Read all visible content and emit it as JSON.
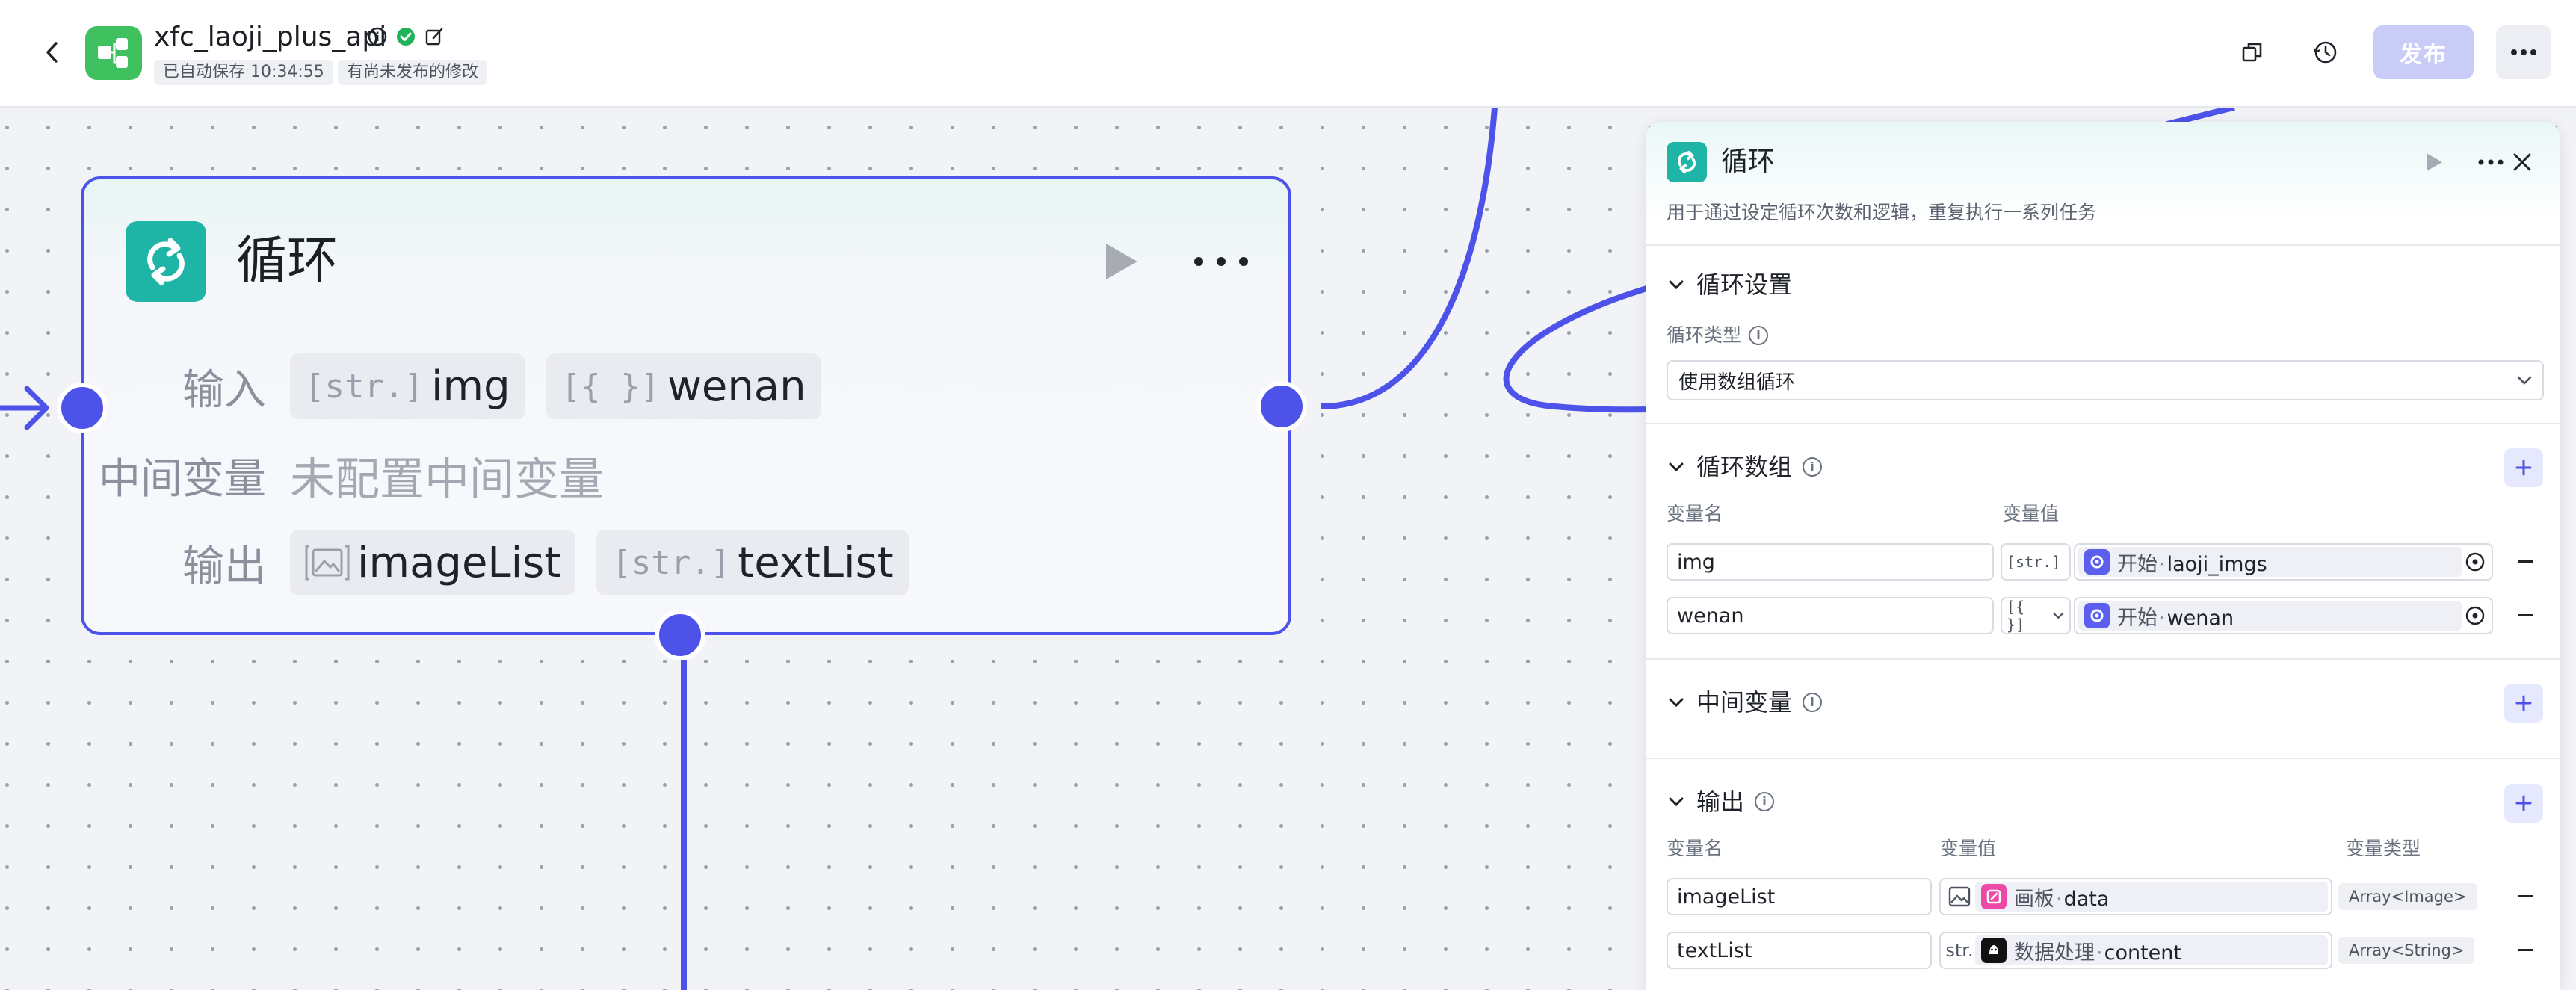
{
  "header": {
    "app_title": "xfc_laoji_plus_api",
    "autosave": "已自动保存 10:34:55",
    "unpublished": "有尚未发布的修改",
    "publish_label": "发布"
  },
  "node": {
    "title": "循环",
    "input_label": "输入",
    "inputs": [
      {
        "type": "[str.]",
        "name": "img"
      },
      {
        "type": "[{ }]",
        "name": "wenan"
      }
    ],
    "middle_label": "中间变量",
    "middle_empty": "未配置中间变量",
    "output_label": "输出",
    "outputs": [
      {
        "type": "image-list-icon",
        "name": "imageList"
      },
      {
        "type": "[str.]",
        "name": "textList"
      }
    ]
  },
  "panel": {
    "title": "循环",
    "description": "用于通过设定循环次数和逻辑，重复执行一系列任务",
    "loop_settings": {
      "title": "循环设置",
      "type_label": "循环类型",
      "type_value": "使用数组循环"
    },
    "loop_array": {
      "title": "循环数组",
      "col_name": "变量名",
      "col_value": "变量值",
      "rows": [
        {
          "name": "img",
          "type": "[str.]",
          "source": "开始",
          "field": "laoji_imgs"
        },
        {
          "name": "wenan",
          "type": "[{ }]",
          "source": "开始",
          "field": "wenan"
        }
      ]
    },
    "middle_vars": {
      "title": "中间变量"
    },
    "output": {
      "title": "输出",
      "col_name": "变量名",
      "col_value": "变量值",
      "col_type": "变量类型",
      "rows": [
        {
          "name": "imageList",
          "type_icon": "image-icon",
          "source": "画板",
          "field": "data",
          "var_type": "Array<Image>"
        },
        {
          "name": "textList",
          "type_icon": "str.",
          "source": "数据处理",
          "field": "content",
          "var_type": "Array<String>"
        }
      ]
    }
  },
  "colors": {
    "accent": "#4d53e8",
    "loop_icon": "#1fb5a6",
    "app_icon": "#3ec15e",
    "publish_disabled": "#c9ccf7",
    "start_node": "#5b5ff0",
    "canvas_node": "#ec4aa6",
    "data_node": "#111111"
  }
}
